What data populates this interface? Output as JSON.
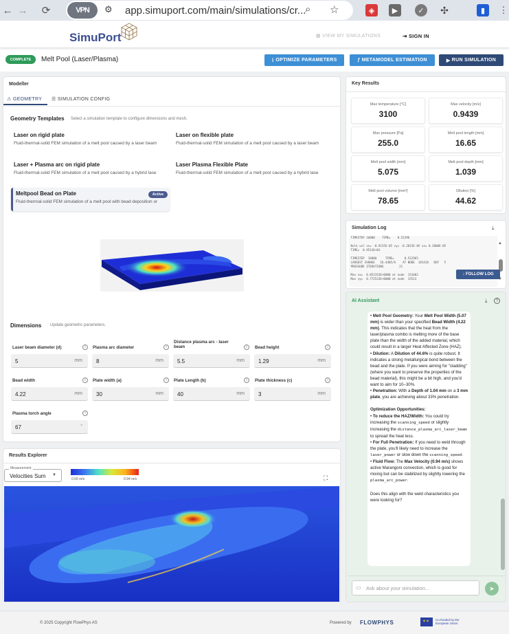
{
  "browser": {
    "vpn": "VPN",
    "url": "app.simuport.com/main/simulations/cr..."
  },
  "header": {
    "logo": "SimuPort",
    "view_sims": "VIEW MY SIMULATIONS",
    "sign_in": "SIGN IN"
  },
  "titlebar": {
    "badge": "COMPLETE",
    "title": "Melt Pool (Laser/Plasma)",
    "optimize": "OPTIMIZE PARAMETERS",
    "metamodel": "METAMODEL ESTIMATION",
    "run": "RUN SIMULATION"
  },
  "colors": {
    "accent_blue": "#3d8fd6",
    "dark_blue": "#2f4a76",
    "complete_green": "#2e9b5a",
    "active_badge": "#4b5a8f"
  },
  "modeller": {
    "title": "Modeller",
    "tabs": [
      {
        "label": "GEOMETRY"
      },
      {
        "label": "SIMULATION CONFIG"
      }
    ],
    "geometry_title": "Geometry Templates",
    "geometry_sub": "Select a simulation template to configure dimensions and mesh.",
    "templates": [
      {
        "title": "Laser on rigid plate",
        "desc": "Fluid-thermal-solid FEM simulation of a melt pool caused by a laser beam"
      },
      {
        "title": "Laser on flexible plate",
        "desc": "Fluid-thermal-solid FEM simulation of a melt pool caused by a laser beam"
      },
      {
        "title": "Laser + Plasma arc on rigid plate",
        "desc": "Fluid-thermal-solid FEM simulation of a melt pool caused by a hybrid lase"
      },
      {
        "title": "Laser Plasma Flexible Plate",
        "desc": "Fluid-thermal-solid FEM simulation of a melt pool caused by a hybrid lase"
      },
      {
        "title": "Meltpool Bead on Plate",
        "desc": "Fluid-thermal-solid FEM simulation of a melt pool with bead deposition or",
        "badge": "Active"
      }
    ],
    "dims_title": "Dimensions",
    "dims_sub": "Update geometric parameters.",
    "fields": [
      {
        "label": "Laser beam diameter (d)",
        "value": "5",
        "unit": "mm"
      },
      {
        "label": "Plasma arc diameter",
        "value": "8",
        "unit": "mm"
      },
      {
        "label": "Distance plasma arc - laser beam",
        "value": "5.5",
        "unit": "mm"
      },
      {
        "label": "Bead height",
        "value": "1.29",
        "unit": "mm"
      },
      {
        "label": "Bead width",
        "value": "4.22",
        "unit": "mm"
      },
      {
        "label": "Plate width (a)",
        "value": "30",
        "unit": "mm"
      },
      {
        "label": "Plate Length (b)",
        "value": "40",
        "unit": "mm"
      },
      {
        "label": "Plate thickness (c)",
        "value": "3",
        "unit": "mm"
      },
      {
        "label": "Plasma torch angle",
        "value": "67",
        "unit": "°"
      }
    ]
  },
  "results": {
    "title": "Results Explorer",
    "measurement_label": "Measurement",
    "measurement": "Velocities Sum",
    "scale_min": "0.00 m/s",
    "scale_max": "0.94 m/s"
  },
  "key_results": {
    "title": "Key Results",
    "items": [
      {
        "label": "Max temperature [°C]",
        "value": "3100"
      },
      {
        "label": "Max velocity [m/s]",
        "value": "0.9439"
      },
      {
        "label": "Max pressure [Pa]",
        "value": "255.0"
      },
      {
        "label": "Melt pool length [mm]",
        "value": "16.65"
      },
      {
        "label": "Melt pool width [mm]",
        "value": "5.075"
      },
      {
        "label": "Melt pool depth [mm]",
        "value": "1.039"
      },
      {
        "label": "Melt pool volume [mm³]",
        "value": "78.65"
      },
      {
        "label": "Dilution [%]",
        "value": "44.62"
      }
    ]
  },
  "log": {
    "title": "Simulation Log",
    "text": " TIMESTEP 16000    TIME=    0.51296\n\n Bulk vol vx= -0.9215E-05 vy= -0.2815E-05 vz= 0.2000E-05\n TIME=  0.95136+01\n\n TIMESTEP  16000     TIME=      0.512965\n LARGEST CHANGE   16.4405/6    AT NODE  181416   DOF   5\n PRESSURE ITERATIONS         21\n\n Max vx=  0.853153E+0000 at node  153402\n Max vy=  0.772523E+0000 at node  15513",
    "follow": "FOLLOW LOG"
  },
  "ai": {
    "title": "AI Assistant",
    "placeholder": "Ask about your simulation...",
    "closing": "Does this align with the weld characteristics you were looking for?"
  },
  "footer": {
    "copyright": "© 2025 Copyright FlowPhys AS",
    "powered": "Powered by",
    "brand": "FLOWPHYS",
    "eu": "Co-funded by the European Union"
  }
}
